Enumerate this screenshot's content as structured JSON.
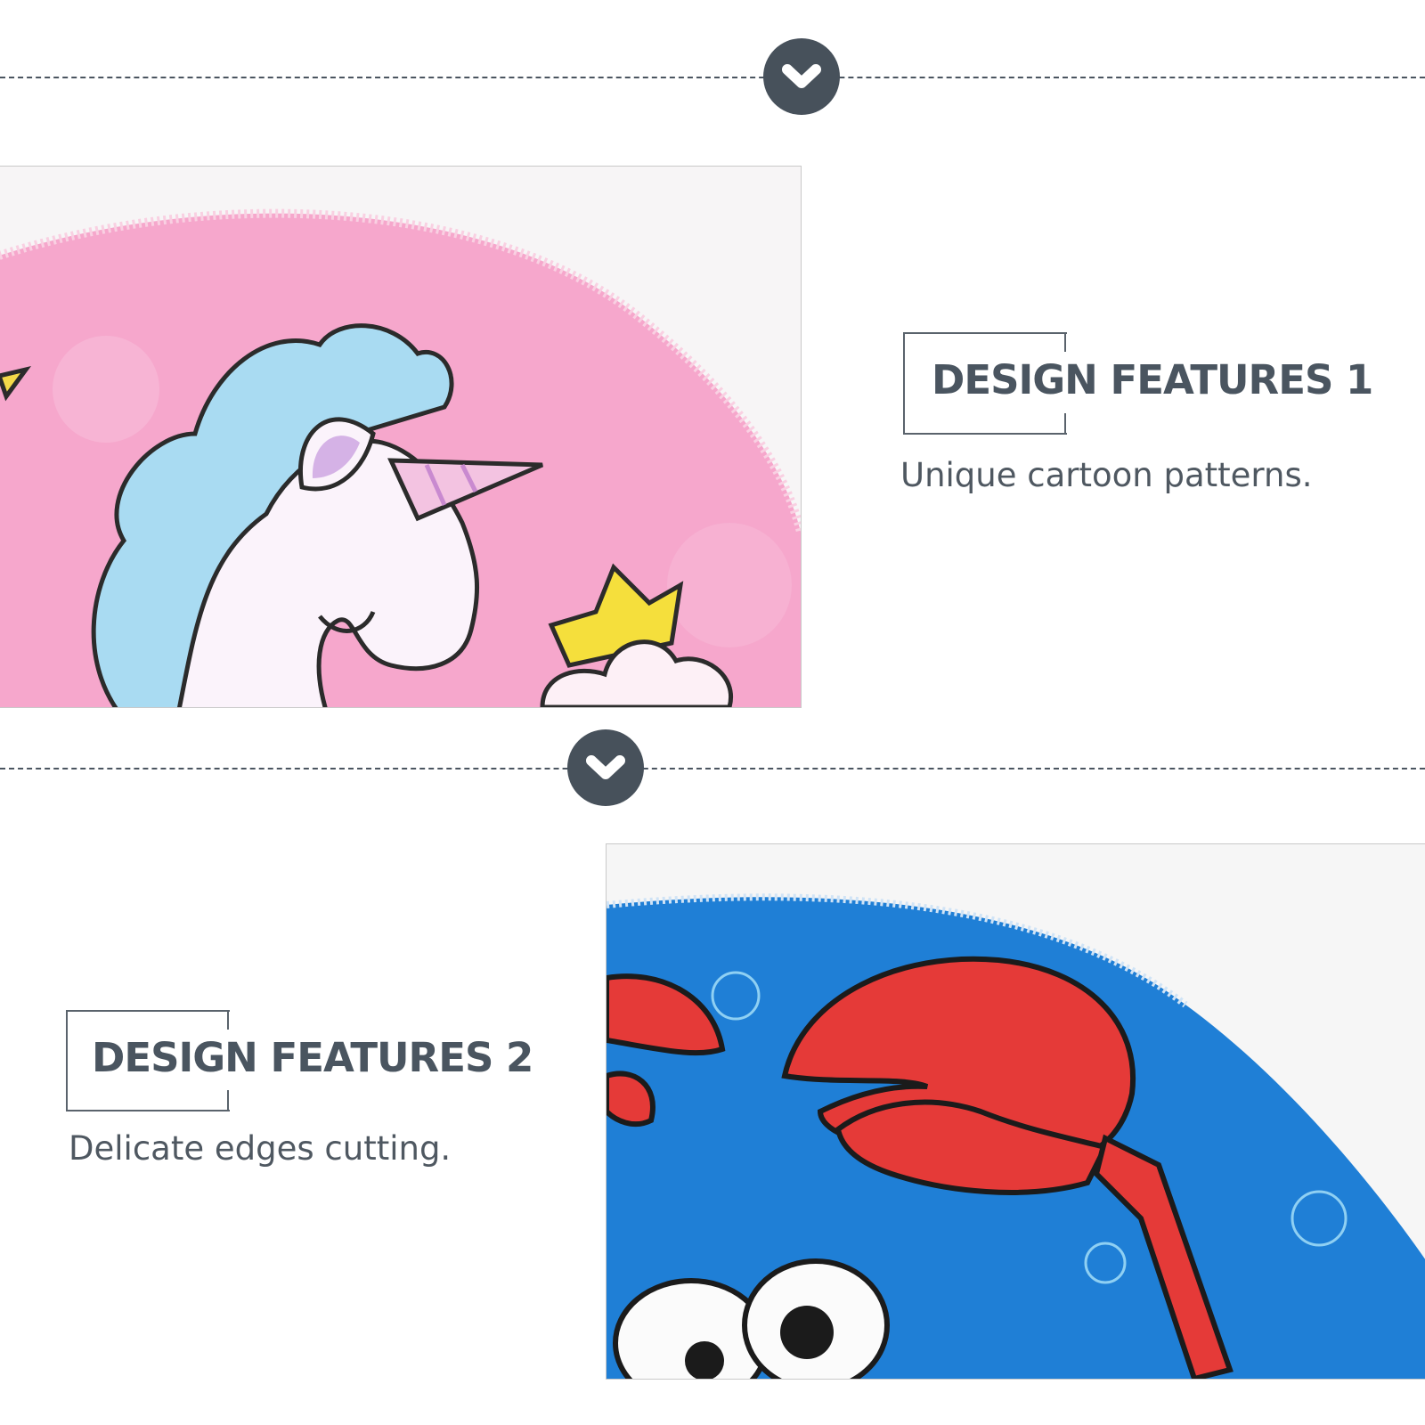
{
  "feature1": {
    "title": "DESIGN FEATURES 1",
    "description": "Unique cartoon patterns."
  },
  "feature2": {
    "title": "DESIGN FEATURES 2",
    "description": "Delicate edges cutting."
  },
  "colors": {
    "badge": "#47515b",
    "pink_fabric": "#f6a7cc",
    "blue_fabric": "#1f7fd6",
    "crab_red": "#e53a38"
  },
  "icons": {
    "badge_icon": "chevron-down-icon"
  }
}
